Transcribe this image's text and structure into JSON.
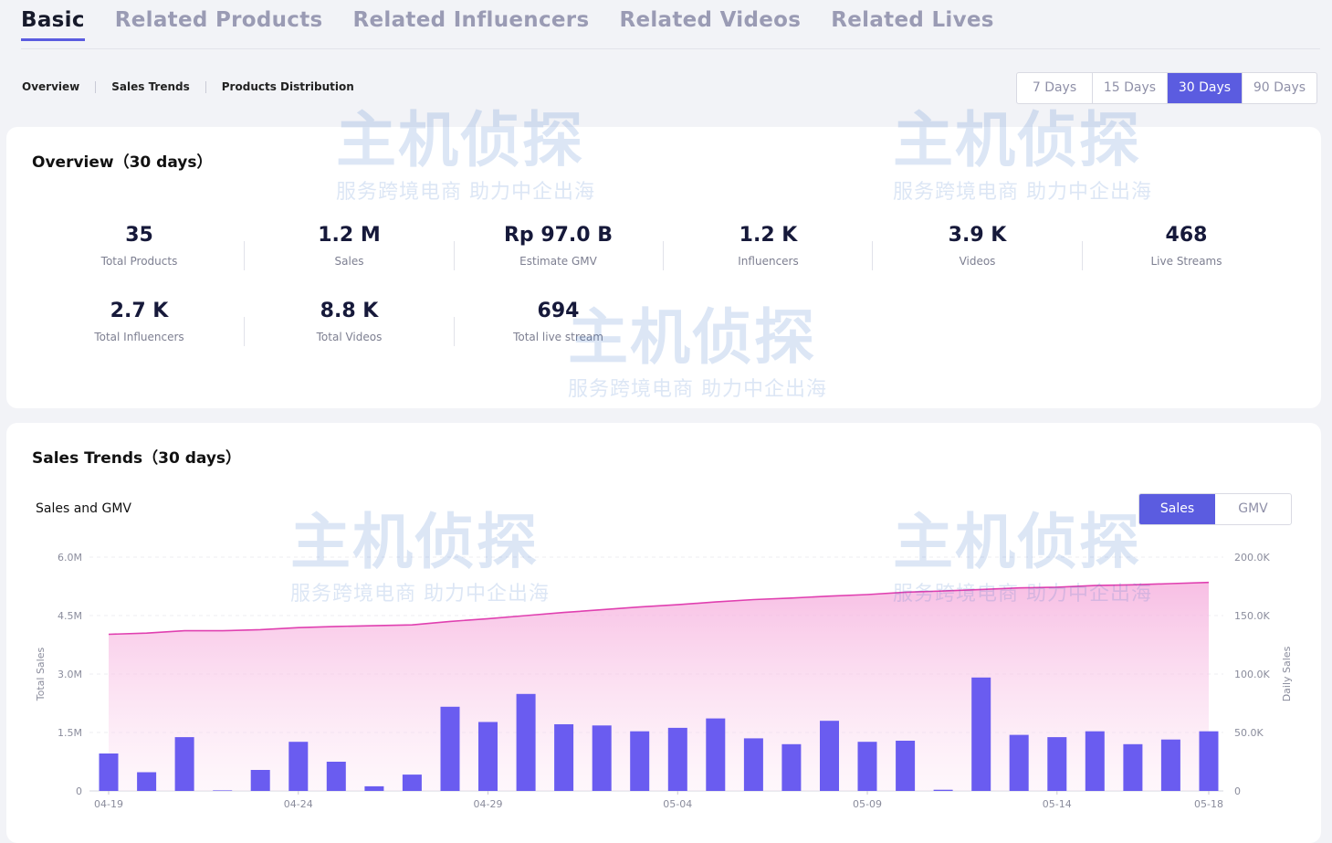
{
  "tabs": [
    "Basic",
    "Related Products",
    "Related Influencers",
    "Related Videos",
    "Related Lives"
  ],
  "active_tab": 0,
  "subnav": [
    "Overview",
    "Sales Trends",
    "Products Distribution"
  ],
  "days": [
    "7 Days",
    "15 Days",
    "30 Days",
    "90 Days"
  ],
  "active_day": 2,
  "overview": {
    "title": "Overview（30 days）",
    "metrics": [
      {
        "value": "35",
        "label": "Total Products"
      },
      {
        "value": "1.2 M",
        "label": "Sales"
      },
      {
        "value": "Rp 97.0 B",
        "label": "Estimate GMV"
      },
      {
        "value": "1.2 K",
        "label": "Influencers"
      },
      {
        "value": "3.9 K",
        "label": "Videos"
      },
      {
        "value": "468",
        "label": "Live Streams"
      },
      {
        "value": "2.7 K",
        "label": "Total Influencers"
      },
      {
        "value": "8.8 K",
        "label": "Total Videos"
      },
      {
        "value": "694",
        "label": "Total live stream"
      }
    ]
  },
  "trends": {
    "title": "Sales Trends（30 days）",
    "subtitle": "Sales and GMV",
    "toggle": [
      "Sales",
      "GMV"
    ],
    "active_toggle": 0
  },
  "watermark": {
    "line1": "主机侦探",
    "line2": "服务跨境电商 助力中企出海"
  },
  "colors": {
    "accent": "#5b5ce0",
    "bar": "#6a5cf0",
    "line": "#e040b0"
  },
  "chart_data": {
    "type": "bar",
    "x": [
      "04-19",
      "04-20",
      "04-21",
      "04-22",
      "04-23",
      "04-24",
      "04-25",
      "04-26",
      "04-27",
      "04-28",
      "04-29",
      "04-30",
      "05-01",
      "05-02",
      "05-03",
      "05-04",
      "05-05",
      "05-06",
      "05-07",
      "05-08",
      "05-09",
      "05-10",
      "05-11",
      "05-12",
      "05-13",
      "05-14",
      "05-15",
      "05-16",
      "05-17",
      "05-18"
    ],
    "x_tick_labels": [
      "04-19",
      "04-24",
      "04-29",
      "05-04",
      "05-09",
      "05-14",
      "05-18"
    ],
    "series": [
      {
        "type": "bar",
        "axis": "right",
        "values": [
          32000,
          16000,
          46000,
          500,
          18000,
          42000,
          25000,
          4000,
          14000,
          72000,
          59000,
          83000,
          57000,
          56000,
          51000,
          54000,
          62000,
          45000,
          40000,
          60000,
          42000,
          43000,
          1000,
          97000,
          48000,
          46000,
          51000,
          40000,
          44000,
          51000
        ]
      },
      {
        "type": "area",
        "axis": "left",
        "values": [
          4020000,
          4050000,
          4110000,
          4110000,
          4140000,
          4190000,
          4220000,
          4240000,
          4260000,
          4350000,
          4420000,
          4500000,
          4580000,
          4650000,
          4720000,
          4780000,
          4850000,
          4910000,
          4950000,
          5000000,
          5040000,
          5100000,
          5130000,
          5170000,
          5210000,
          5230000,
          5270000,
          5290000,
          5320000,
          5350000
        ]
      }
    ],
    "ylabel": "Total Sales",
    "y2label": "Daily Sales",
    "ylim": [
      0,
      6000000
    ],
    "y2lim": [
      0,
      200000
    ],
    "yticks": [
      "0",
      "1.5M",
      "3.0M",
      "4.5M",
      "6.0M"
    ],
    "y2ticks": [
      "0",
      "50.0K",
      "100.0K",
      "150.0K",
      "200.0K"
    ],
    "grid": true
  }
}
